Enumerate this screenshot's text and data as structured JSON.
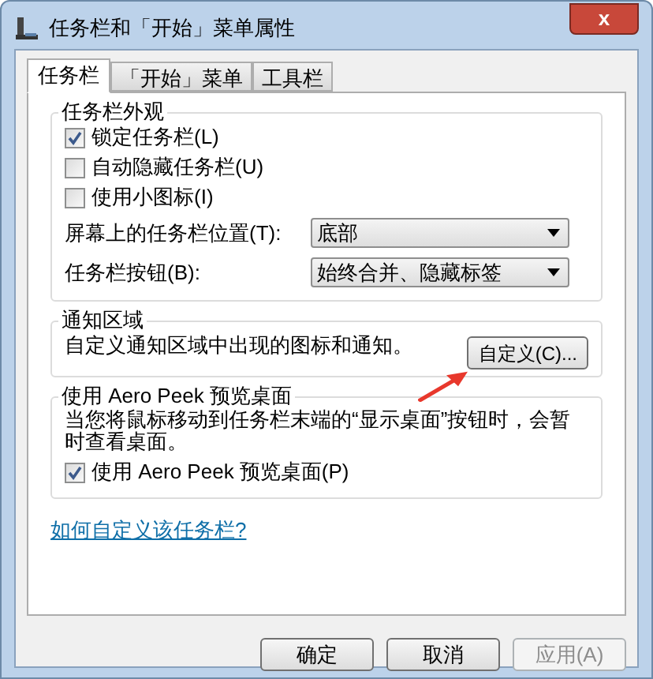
{
  "window": {
    "title": "任务栏和「开始」菜单属性",
    "close": "x"
  },
  "tabs": [
    {
      "label": "任务栏",
      "selected": true
    },
    {
      "label": "「开始」菜单",
      "selected": false
    },
    {
      "label": "工具栏",
      "selected": false
    }
  ],
  "appearance": {
    "title": "任务栏外观",
    "checkboxes": [
      {
        "label": "锁定任务栏(L)",
        "checked": true
      },
      {
        "label": "自动隐藏任务栏(U)",
        "checked": false
      },
      {
        "label": "使用小图标(I)",
        "checked": false
      }
    ],
    "dropdowns": [
      {
        "label": "屏幕上的任务栏位置(T):",
        "value": "底部"
      },
      {
        "label": "任务栏按钮(B):",
        "value": "始终合并、隐藏标签"
      }
    ]
  },
  "notification": {
    "title": "通知区域",
    "text": "自定义通知区域中出现的图标和通知。",
    "button": "自定义(C)..."
  },
  "aero_peek": {
    "title": "使用 Aero Peek 预览桌面",
    "text": "当您将鼠标移动到任务栏末端的“显示桌面”按钮时，会暂时查看桌面。",
    "checkbox": {
      "label": "使用 Aero Peek 预览桌面(P)",
      "checked": true
    }
  },
  "link": "如何自定义该任务栏?",
  "buttons": [
    {
      "label": "确定",
      "disabled": false
    },
    {
      "label": "取消",
      "disabled": false
    },
    {
      "label": "应用(A)",
      "disabled": true
    }
  ],
  "annotation": {
    "kind": "arrow"
  }
}
